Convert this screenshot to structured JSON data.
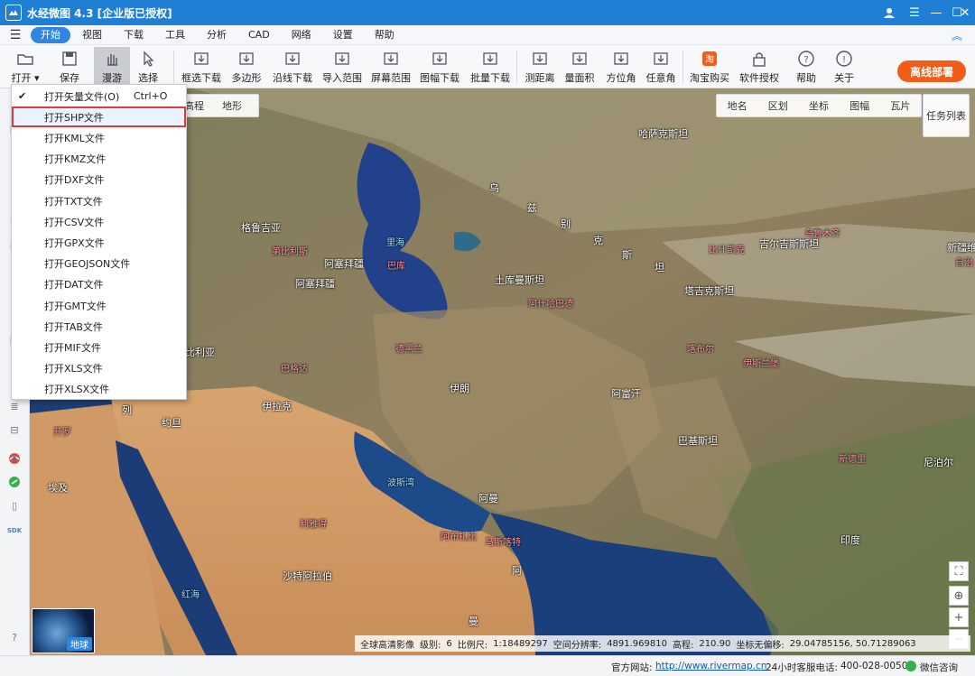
{
  "window": {
    "title": "水经微图 4.3 [企业版已授权]",
    "buttons": [
      "user",
      "menu",
      "minimize",
      "maximize",
      "close"
    ]
  },
  "menubar": {
    "items": [
      {
        "label": "开始",
        "active": true
      },
      {
        "label": "视图"
      },
      {
        "label": "下载"
      },
      {
        "label": "工具"
      },
      {
        "label": "分析"
      },
      {
        "label": "CAD"
      },
      {
        "label": "网络"
      },
      {
        "label": "设置"
      },
      {
        "label": "帮助"
      }
    ]
  },
  "toolbar": {
    "items": [
      {
        "label": "打开 ▾",
        "icon": "folder-icon"
      },
      {
        "label": "保存",
        "icon": "save-icon"
      },
      {
        "label": "漫游",
        "icon": "hand-icon",
        "active": true
      },
      {
        "label": "选择",
        "icon": "cursor-icon"
      },
      {
        "label": "框选下载",
        "icon": "box-download-icon"
      },
      {
        "label": "多边形",
        "icon": "polygon-icon"
      },
      {
        "label": "沿线下载",
        "icon": "line-download-icon"
      },
      {
        "label": "导入范围",
        "icon": "import-range-icon"
      },
      {
        "label": "屏幕范围",
        "icon": "screen-range-icon"
      },
      {
        "label": "图幅下载",
        "icon": "sheet-download-icon"
      },
      {
        "label": "批量下载",
        "icon": "batch-download-icon"
      },
      {
        "label": "测距离",
        "icon": "ruler-icon"
      },
      {
        "label": "量面积",
        "icon": "area-icon"
      },
      {
        "label": "方位角",
        "icon": "azimuth-icon"
      },
      {
        "label": "任意角",
        "icon": "angle-icon"
      },
      {
        "label": "淘宝购买",
        "icon": "taobao-icon"
      },
      {
        "label": "软件授权",
        "icon": "lock-icon"
      },
      {
        "label": "帮助",
        "icon": "question-icon"
      },
      {
        "label": "关于",
        "icon": "info-icon"
      }
    ],
    "offline_button": "离线部署"
  },
  "map_tabs_left": [
    "高程",
    "地形"
  ],
  "map_tabs_right": [
    "地名",
    "区划",
    "坐标",
    "图幅",
    "瓦片"
  ],
  "task_list": "任务列表",
  "globe_label": "地球",
  "place_labels": [
    {
      "text": "哈萨克斯坦",
      "cls": "w"
    },
    {
      "text": "乌",
      "cls": "w"
    },
    {
      "text": "兹",
      "cls": "w"
    },
    {
      "text": "别",
      "cls": "w"
    },
    {
      "text": "克",
      "cls": "w"
    },
    {
      "text": "斯",
      "cls": "w"
    },
    {
      "text": "坦",
      "cls": "w"
    },
    {
      "text": "格鲁吉亚",
      "cls": "w"
    },
    {
      "text": "第比利斯",
      "cls": "r"
    },
    {
      "text": "阿塞拜疆",
      "cls": "w"
    },
    {
      "text": "阿塞拜疆",
      "cls": "w"
    },
    {
      "text": "里海",
      "cls": "c"
    },
    {
      "text": "巴库",
      "cls": "r"
    },
    {
      "text": "土库曼斯坦",
      "cls": "w"
    },
    {
      "text": "阿什哈巴德",
      "cls": "r"
    },
    {
      "text": "塔吉克斯坦",
      "cls": "w"
    },
    {
      "text": "吉尔吉斯斯坦",
      "cls": "w"
    },
    {
      "text": "比什凯克",
      "cls": "r"
    },
    {
      "text": "乌鲁木齐",
      "cls": "r"
    },
    {
      "text": "新疆维",
      "cls": "w"
    },
    {
      "text": "自治",
      "cls": "r"
    },
    {
      "text": "比利亚",
      "cls": "w"
    },
    {
      "text": "巴格达",
      "cls": "r"
    },
    {
      "text": "德黑兰",
      "cls": "r"
    },
    {
      "text": "喀布尔",
      "cls": "r"
    },
    {
      "text": "伊斯兰堡",
      "cls": "r"
    },
    {
      "text": "伊拉克",
      "cls": "w"
    },
    {
      "text": "伊朗",
      "cls": "w"
    },
    {
      "text": "阿富汗",
      "cls": "w"
    },
    {
      "text": "列",
      "cls": "w"
    },
    {
      "text": "约旦",
      "cls": "w"
    },
    {
      "text": "开罗",
      "cls": "r"
    },
    {
      "text": "巴基斯坦",
      "cls": "w"
    },
    {
      "text": "新德里",
      "cls": "r"
    },
    {
      "text": "尼泊尔",
      "cls": "w"
    },
    {
      "text": "埃及",
      "cls": "w"
    },
    {
      "text": "波斯湾",
      "cls": "c"
    },
    {
      "text": "阿曼",
      "cls": "w"
    },
    {
      "text": "阿布扎比",
      "cls": "r"
    },
    {
      "text": "马斯喀特",
      "cls": "r"
    },
    {
      "text": "利雅得",
      "cls": "r"
    },
    {
      "text": "沙特阿拉伯",
      "cls": "w"
    },
    {
      "text": "阿",
      "cls": "w"
    },
    {
      "text": "红海",
      "cls": "c"
    },
    {
      "text": "印度",
      "cls": "w"
    },
    {
      "text": "曼",
      "cls": "w"
    }
  ],
  "map_status": {
    "layer": "全球高清影像",
    "level_label": "级别:",
    "level": "6",
    "scale_label": "比例尺:",
    "scale": "1:18489297",
    "res_label": "空间分辨率:",
    "res": "4891.969810",
    "elev_label": "高程:",
    "elev": "210.90",
    "coord_label": "坐标无偏移:",
    "coord": "29.04785156, 50.71289063"
  },
  "statusbar": {
    "site_label": "官方网站:",
    "site_url": "http://www.rivermap.cn",
    "phone_label": "24小时客服电话:",
    "phone": "400-028-0050",
    "wechat": "微信咨询"
  },
  "open_menu": {
    "items": [
      {
        "label": "打开矢量文件(O)",
        "shortcut": "Ctrl+O",
        "checked": true
      },
      {
        "label": "打开SHP文件",
        "highlighted": true
      },
      {
        "label": "打开KML文件"
      },
      {
        "label": "打开KMZ文件"
      },
      {
        "label": "打开DXF文件"
      },
      {
        "label": "打开TXT文件"
      },
      {
        "label": "打开CSV文件"
      },
      {
        "label": "打开GPX文件"
      },
      {
        "label": "打开GEOJSON文件"
      },
      {
        "label": "打开DAT文件"
      },
      {
        "label": "打开GMT文件"
      },
      {
        "label": "打开TAB文件"
      },
      {
        "label": "打开MIF文件"
      },
      {
        "label": "打开XLS文件"
      },
      {
        "label": "打开XLSX文件"
      }
    ]
  },
  "colors": {
    "title_bar": "#1f7fd4",
    "accent": "#2f86e0",
    "offline": "#f25c19",
    "highlight_border": "#e03c3c"
  }
}
